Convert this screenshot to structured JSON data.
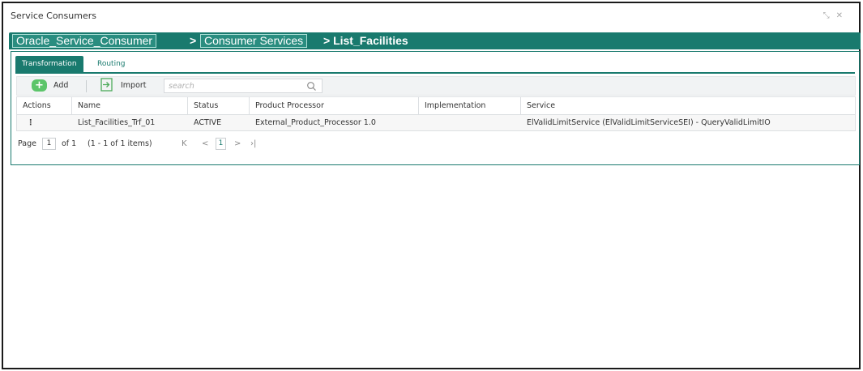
{
  "window": {
    "title": "Service Consumers",
    "controls": {
      "restore_glyph": "⤡",
      "close_glyph": "✕"
    }
  },
  "breadcrumb": {
    "items": [
      "Oracle_Service_Consumer",
      "Consumer Services"
    ],
    "separator": ">",
    "current": "> List_Facilities"
  },
  "tabs": [
    {
      "label": "Transformation",
      "active": true
    },
    {
      "label": "Routing",
      "active": false
    }
  ],
  "toolbar": {
    "add_label": "Add",
    "import_label": "Import",
    "search_placeholder": "search"
  },
  "grid": {
    "columns": [
      "Actions",
      "Name",
      "Status",
      "Product Processor",
      "Implementation",
      "Service"
    ],
    "rows": [
      {
        "actions": "⋮",
        "name": "List_Facilities_Trf_01",
        "status": "ACTIVE",
        "product_processor": "External_Product_Processor 1.0",
        "implementation": "",
        "service": "ElValidLimitService (ElValidLimitServiceSEI) - QueryValidLimitIO"
      }
    ]
  },
  "pager": {
    "page_label": "Page",
    "page_value": "1",
    "of_label": "of 1",
    "items_label": "(1 - 1 of 1 items)",
    "first_glyph": "K",
    "prev_glyph": "<",
    "current_page": "1",
    "next_glyph": ">",
    "last_glyph": "›|"
  },
  "colors": {
    "accent": "#197a6e",
    "add_green": "#5cc56a",
    "toolbar_bg": "#f1f3f4"
  }
}
